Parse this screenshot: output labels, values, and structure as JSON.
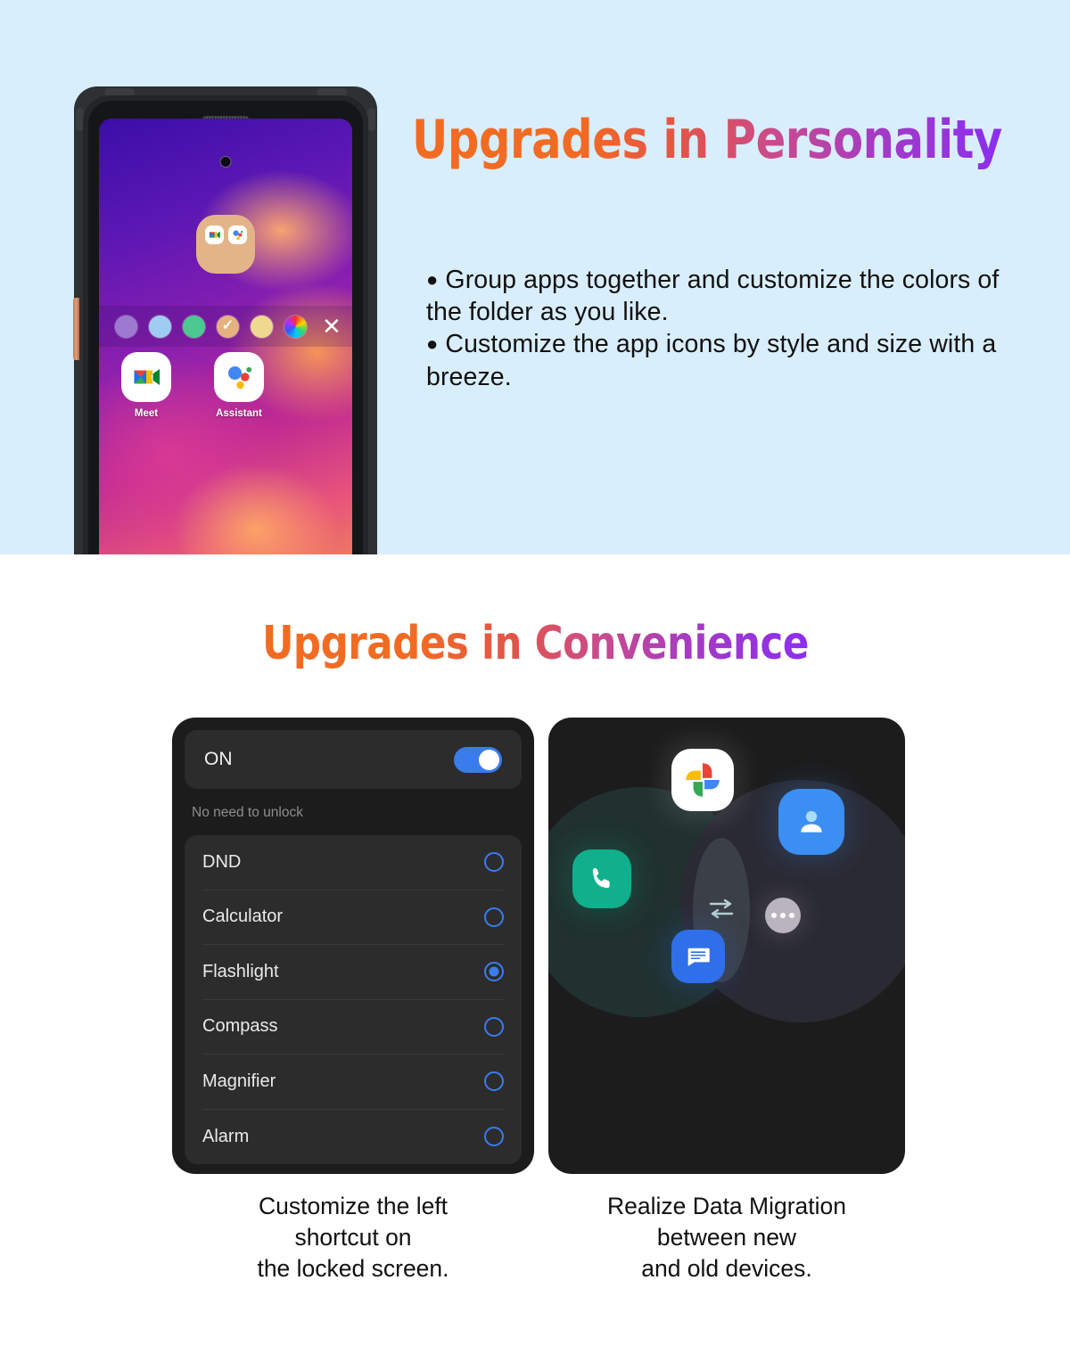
{
  "colors": {
    "section_bg": "#d9eefc",
    "page_bg": "#ffffff",
    "title_gradient_start": "#f26b22",
    "title_gradient_end": "#8b2ef0",
    "accent_blue": "#3b7ced",
    "panel_dark": "#1c1c1c",
    "card_dark": "#2c2c2c",
    "folder_tan": "#e4b489"
  },
  "section_personality": {
    "title": "Upgrades in Personality",
    "bullets": [
      "Group apps together and customize the colors of the folder as you like.",
      "Customize the app icons by style and size with a breeze."
    ],
    "bullet_marker": "●",
    "phone": {
      "folder": {
        "apps": [
          {
            "name": "Google Meet",
            "icon": "meet-icon"
          },
          {
            "name": "Google Assistant",
            "icon": "assistant-icon"
          }
        ]
      },
      "color_palette": {
        "swatches": [
          {
            "name": "purple",
            "color": "#9b7ad0",
            "selected": false
          },
          {
            "name": "light-blue",
            "color": "#9fcdf2",
            "selected": false
          },
          {
            "name": "green",
            "color": "#4cc98e",
            "selected": false
          },
          {
            "name": "tan",
            "color": "#e5b27f",
            "selected": true
          },
          {
            "name": "light-yellow",
            "color": "#efd98e",
            "selected": false
          },
          {
            "name": "rainbow",
            "color": "rainbow",
            "selected": false
          }
        ],
        "check_glyph": "✓",
        "close_glyph": "✕"
      },
      "home_apps": [
        {
          "label": "Meet",
          "icon": "meet-icon"
        },
        {
          "label": "Assistant",
          "icon": "assistant-icon"
        }
      ]
    }
  },
  "section_convenience": {
    "title": "Upgrades in Convenience",
    "shortcut_panel": {
      "toggle_label": "ON",
      "toggle_state": "on",
      "hint": "No need to unlock",
      "items": [
        {
          "label": "DND",
          "selected": false
        },
        {
          "label": "Calculator",
          "selected": false
        },
        {
          "label": "Flashlight",
          "selected": true
        },
        {
          "label": "Compass",
          "selected": false
        },
        {
          "label": "Magnifier",
          "selected": false
        },
        {
          "label": "Alarm",
          "selected": false
        }
      ],
      "caption": "Customize the left\nshortcut on\nthe locked screen."
    },
    "migration_panel": {
      "icons": [
        {
          "name": "google-photos-icon"
        },
        {
          "name": "phone-icon"
        },
        {
          "name": "contacts-icon"
        },
        {
          "name": "messages-icon"
        },
        {
          "name": "more-dots-icon"
        },
        {
          "name": "transfer-arrows-icon"
        }
      ],
      "caption": "Realize Data Migration\nbetween new\nand old devices."
    }
  }
}
